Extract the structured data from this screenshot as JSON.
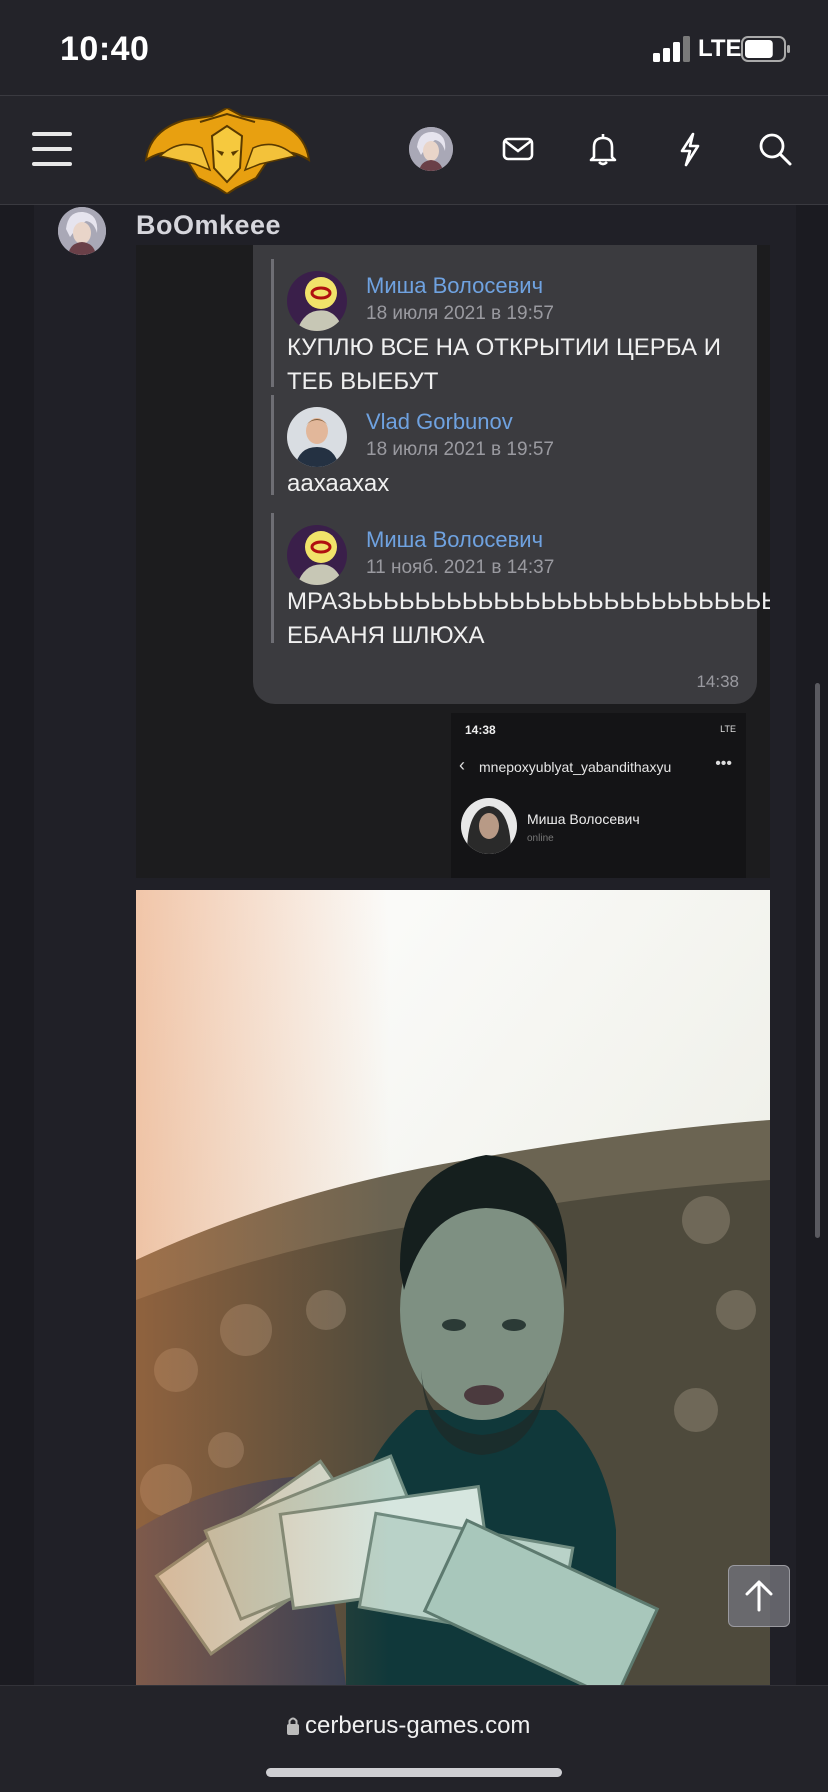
{
  "status_bar": {
    "time": "10:40",
    "network": "LTE",
    "battery_level": 0.75
  },
  "header": {
    "icons": [
      "menu-icon",
      "site-logo",
      "user-avatar",
      "mail-icon",
      "bell-icon",
      "lightning-icon",
      "search-icon"
    ]
  },
  "post": {
    "author": "BoOmkeee",
    "screenshot": {
      "messages": [
        {
          "name": "Миша Волосевич",
          "date": "18 июля 2021 в 19:57",
          "text": "КУПЛЮ ВСЕ НА ОТКРЫТИИ ЦЕРБА И ТЕБ ВЫЕБУТ"
        },
        {
          "name": "Vlad Gorbunov",
          "date": "18 июля 2021 в 19:57",
          "text": "аахаахах"
        },
        {
          "name": "Миша Волосевич",
          "date": "11 нояб. 2021 в 14:37",
          "text": "МРАЗЬЬЬЬЬЬЬЬЬЬЬЬЬЬЬЬЬЬЬЬЬЬЬЬЬЬЬЬЬЬЬЬ ЕБААНЯ ШЛЮХА"
        }
      ],
      "bubble_time": "14:38",
      "mini_time": "14:38",
      "mini_status": "LTE",
      "mini_handle": "mnepoxyublyat_yabandithaxyu",
      "mini_name": "Миша Волосевич",
      "mini_online": "online"
    }
  },
  "footer": {
    "url": "cerberus-games.com"
  },
  "colors": {
    "link_blue": "#6fa2e0",
    "bubble_bg": "#3b3b3f",
    "panel_bg": "#202027",
    "logo_orange": "#e8a010"
  }
}
